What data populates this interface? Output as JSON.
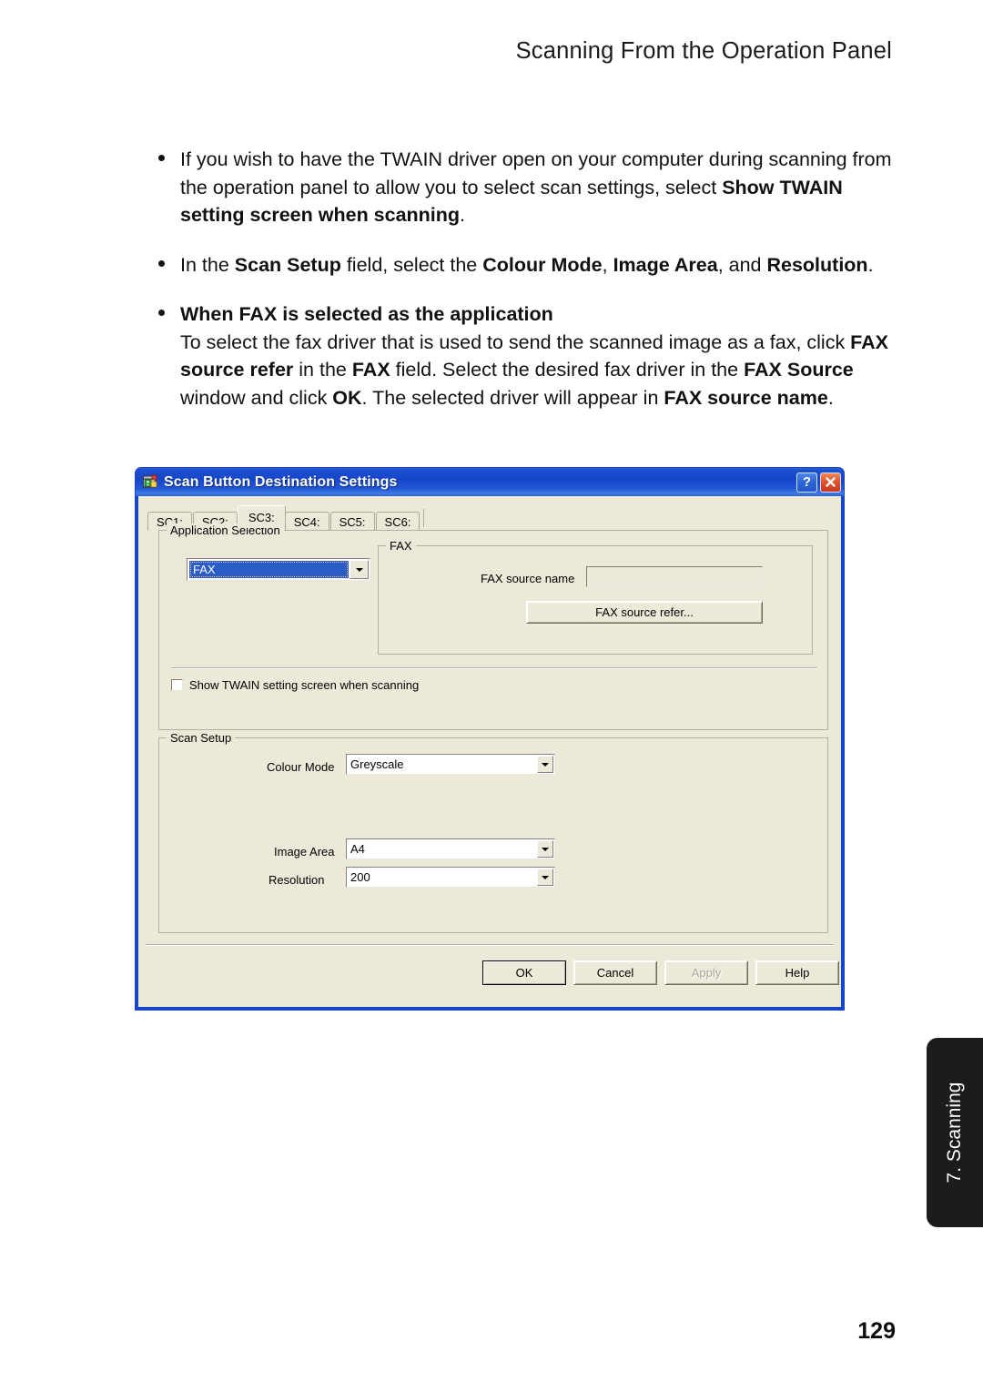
{
  "page": {
    "header": "Scanning From the Operation Panel",
    "number": "129",
    "side_tab": "7. Scanning"
  },
  "content": {
    "bullets": [
      {
        "id": "twain-note",
        "segments": [
          {
            "text": "If you wish to have the TWAIN driver open on your computer during scanning from the operation panel to allow you to select scan settings, select ",
            "bold": false
          },
          {
            "text": "Show TWAIN setting screen when scanning",
            "bold": true
          },
          {
            "text": ".",
            "bold": false
          }
        ]
      },
      {
        "id": "scan-setup-note",
        "segments": [
          {
            "text": "In the ",
            "bold": false
          },
          {
            "text": "Scan Setup",
            "bold": true
          },
          {
            "text": " field, select the ",
            "bold": false
          },
          {
            "text": "Colour Mode",
            "bold": true
          },
          {
            "text": ", ",
            "bold": false
          },
          {
            "text": "Image Area",
            "bold": true
          },
          {
            "text": ", and ",
            "bold": false
          },
          {
            "text": "Resolution",
            "bold": true
          },
          {
            "text": ".",
            "bold": false
          }
        ]
      },
      {
        "id": "fax-application-note",
        "heading": "When FAX is selected as the application",
        "segments": [
          {
            "text": "To select the fax driver that is used to send the scanned image as a fax, click ",
            "bold": false
          },
          {
            "text": "FAX source refer",
            "bold": true
          },
          {
            "text": " in the ",
            "bold": false
          },
          {
            "text": "FAX",
            "bold": true
          },
          {
            "text": " field. Select the desired fax driver in the ",
            "bold": false
          },
          {
            "text": "FAX Source",
            "bold": true
          },
          {
            "text": " window and click ",
            "bold": false
          },
          {
            "text": "OK",
            "bold": true
          },
          {
            "text": ". The selected driver will appear in ",
            "bold": false
          },
          {
            "text": "FAX source name",
            "bold": true
          },
          {
            "text": ".",
            "bold": false
          }
        ]
      }
    ]
  },
  "dialog": {
    "title": "Scan Button Destination Settings",
    "icon": "application-window-icon",
    "titlebar_buttons": [
      {
        "name": "help-button",
        "label": "?"
      },
      {
        "name": "close-button",
        "label": "✕"
      }
    ],
    "tabs": [
      {
        "label": "SC1:",
        "active": false
      },
      {
        "label": "SC2:",
        "active": false
      },
      {
        "label": "SC3:",
        "active": true
      },
      {
        "label": "SC4:",
        "active": false
      },
      {
        "label": "SC5:",
        "active": false
      },
      {
        "label": "SC6:",
        "active": false
      }
    ],
    "application_selection": {
      "legend": "Application Selection",
      "application_value": "FAX",
      "fax_group": {
        "legend": "FAX",
        "source_name_label": "FAX source name",
        "source_name_value": "",
        "refer_button": "FAX source refer..."
      },
      "show_twain_checkbox": {
        "label": "Show TWAIN setting screen when scanning",
        "checked": false
      }
    },
    "scan_setup": {
      "legend": "Scan Setup",
      "fields": [
        {
          "label": "Colour Mode",
          "value": "Greyscale"
        },
        {
          "label": "Image Area",
          "value": "A4"
        },
        {
          "label": "Resolution",
          "value": "200"
        }
      ]
    },
    "footer_buttons": [
      {
        "label": "OK",
        "state": "default"
      },
      {
        "label": "Cancel",
        "state": "normal"
      },
      {
        "label": "Apply",
        "state": "disabled"
      },
      {
        "label": "Help",
        "state": "normal"
      }
    ]
  },
  "colors": {
    "titlebar_blue": "#1846c8",
    "dialog_face": "#ece9d8",
    "selection_blue": "#2b5dc9",
    "close_red": "#c9381b",
    "side_tab_black": "#1c1c1c"
  }
}
